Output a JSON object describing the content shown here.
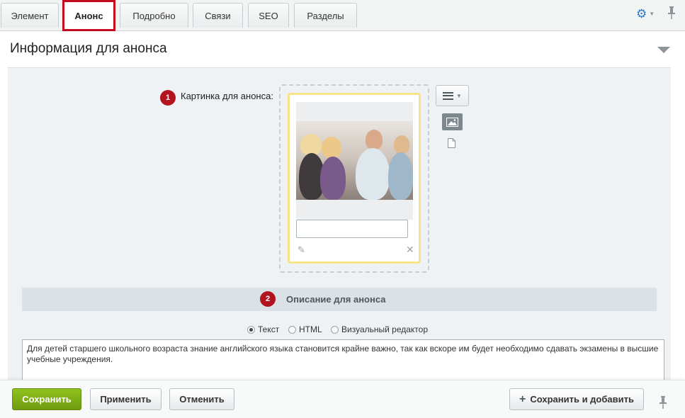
{
  "tabs": [
    {
      "label": "Элемент"
    },
    {
      "label": "Анонс"
    },
    {
      "label": "Подробно"
    },
    {
      "label": "Связи"
    },
    {
      "label": "SEO"
    },
    {
      "label": "Разделы"
    }
  ],
  "section": {
    "title": "Информация для анонса"
  },
  "preview_picture": {
    "label": "Картинка для анонса:",
    "badge": "1",
    "description_value": ""
  },
  "description": {
    "badge": "2",
    "title": "Описание для анонса",
    "modes": [
      {
        "label": "Текст",
        "selected": true
      },
      {
        "label": "HTML",
        "selected": false
      },
      {
        "label": "Визуальный редактор",
        "selected": false
      }
    ],
    "text": "Для детей старшего школьного возраста знание английского языка становится крайне важно, так как вскоре им будет необходимо сдавать экзамены в высшие учебные учреждения."
  },
  "buttons": {
    "save": "Сохранить",
    "apply": "Применить",
    "cancel": "Отменить",
    "save_add": "Сохранить и добавить"
  },
  "icons": {
    "gear": "gear-icon",
    "pin": "pin-icon",
    "collapse": "triangle-down-icon",
    "menu": "hamburger-icon",
    "image_mode": "image-icon",
    "file_mode": "document-icon",
    "edit": "pencil-icon",
    "delete": "close-icon",
    "add": "plus-icon"
  },
  "colors": {
    "accent_green": "#7cab16",
    "active_tab_border": "#c30d1f",
    "badge": "#b3131f",
    "gear_blue": "#2f7bc1"
  }
}
